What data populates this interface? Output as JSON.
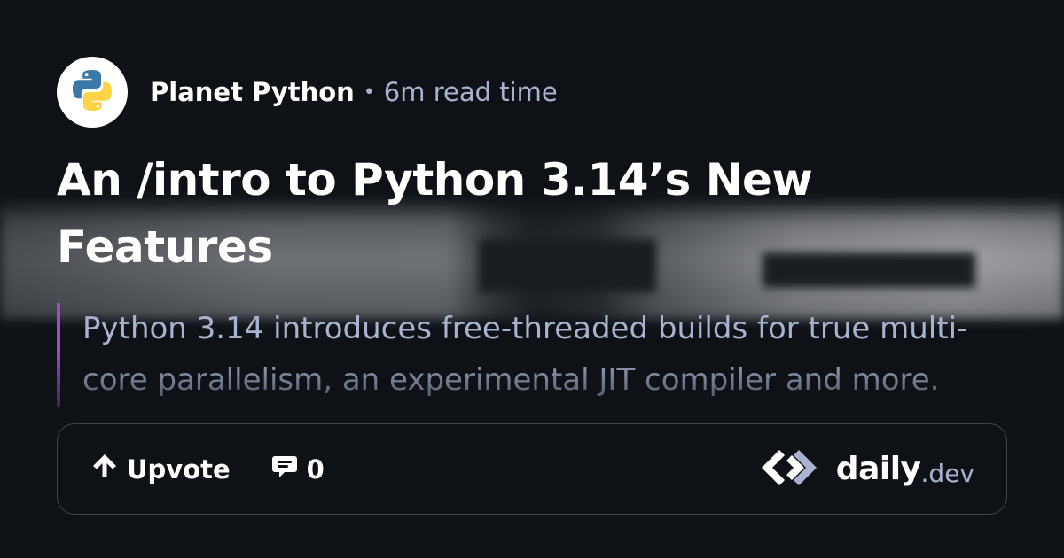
{
  "header": {
    "source_name": "Planet Python",
    "separator": "•",
    "read_time": "6m read time",
    "avatar_icon": "python-logo-icon"
  },
  "post": {
    "title": "An /intro to Python 3.14’s New Features",
    "summary": "Python 3.14 introduces free-threaded builds for true multi-core parallelism, an experimental JIT compiler and more."
  },
  "actions": {
    "upvote_label": "Upvote",
    "upvote_icon": "arrow-up-icon",
    "comments_count": "0",
    "comments_icon": "comment-icon"
  },
  "brand": {
    "name_main": "daily",
    "name_suffix": ".dev",
    "logo_icon": "daily-dev-logo-icon"
  },
  "colors": {
    "background": "#0e1217",
    "muted_text": "#a8b3cf",
    "accent_bar": "#9d4bce",
    "border": "#3f454e"
  }
}
